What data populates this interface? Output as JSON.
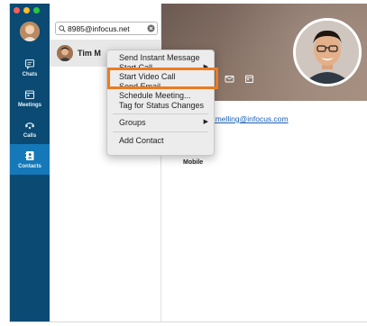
{
  "sidebar": {
    "items": [
      {
        "label": "Chats",
        "icon": "chat-icon"
      },
      {
        "label": "Meetings",
        "icon": "calendar-icon"
      },
      {
        "label": "Calls",
        "icon": "phone-icon"
      },
      {
        "label": "Contacts",
        "icon": "contacts-icon",
        "active": true
      }
    ],
    "accent": "#1578b8",
    "background": "#0a4a73"
  },
  "search": {
    "value": "8985@infocus.net"
  },
  "contact": {
    "name": "Tim M"
  },
  "detail": {
    "email": "tim.melling@infocus.com",
    "mobile_label": "Mobile"
  },
  "context_menu": {
    "items": [
      {
        "label": "Send Instant Message"
      },
      {
        "label": "Start Call",
        "submenu": true
      },
      {
        "label": "Start Video Call",
        "highlighted": true
      },
      {
        "label": "Send Email..."
      },
      {
        "label": "Schedule Meeting..."
      },
      {
        "label": "Tag for Status Changes"
      },
      {
        "label": "Groups",
        "submenu": true
      },
      {
        "label": "Add Contact"
      }
    ],
    "highlight_color": "#ee7a22"
  }
}
